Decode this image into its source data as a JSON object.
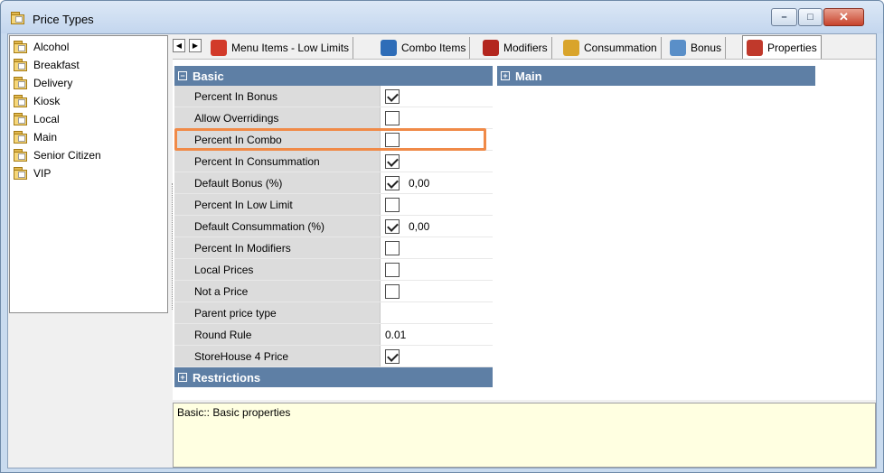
{
  "window": {
    "title": "Price Types",
    "minimize_glyph": "–",
    "maximize_glyph": "□",
    "close_glyph": "✕"
  },
  "sidebar": {
    "items": [
      {
        "label": "Alcohol"
      },
      {
        "label": "Breakfast"
      },
      {
        "label": "Delivery"
      },
      {
        "label": "Kiosk"
      },
      {
        "label": "Local"
      },
      {
        "label": "Main"
      },
      {
        "label": "Senior Citizen"
      },
      {
        "label": "VIP"
      }
    ]
  },
  "tabs": {
    "prev_glyph": "◀",
    "next_glyph": "▶",
    "items": [
      {
        "label": "Menu Items - Low Limits",
        "icon": "pie-chart-icon",
        "color": "#d23a2a"
      },
      {
        "label": "Combo Items",
        "icon": "combo-icon",
        "color": "#2e6db8"
      },
      {
        "label": "Modifiers",
        "icon": "bottles-icon",
        "color": "#b3261e"
      },
      {
        "label": "Consummation",
        "icon": "hourglass-icon",
        "color": "#d9a42b"
      },
      {
        "label": "Bonus",
        "icon": "calculator-icon",
        "color": "#5a8fc8"
      },
      {
        "label": "Properties",
        "icon": "properties-icon",
        "color": "#c0392b"
      }
    ]
  },
  "grid": {
    "basic_category": "Basic",
    "basic_toggle": "−",
    "main_category": "Main",
    "main_toggle": "+",
    "restrictions_category": "Restrictions",
    "restrictions_toggle": "+",
    "rows": [
      {
        "name": "Percent In Bonus",
        "checkbox": true,
        "checked": true,
        "value": ""
      },
      {
        "name": "Allow Overridings",
        "checkbox": true,
        "checked": false,
        "value": ""
      },
      {
        "name": "Percent In Combo",
        "checkbox": true,
        "checked": false,
        "value": ""
      },
      {
        "name": "Percent In Consummation",
        "checkbox": true,
        "checked": true,
        "value": ""
      },
      {
        "name": "Default Bonus (%)",
        "checkbox": true,
        "checked": true,
        "value": "0,00"
      },
      {
        "name": "Percent In Low Limit",
        "checkbox": true,
        "checked": false,
        "value": ""
      },
      {
        "name": "Default Consummation (%)",
        "checkbox": true,
        "checked": true,
        "value": "0,00"
      },
      {
        "name": "Percent In Modifiers",
        "checkbox": true,
        "checked": false,
        "value": ""
      },
      {
        "name": "Local Prices",
        "checkbox": true,
        "checked": false,
        "value": ""
      },
      {
        "name": "Not a Price",
        "checkbox": true,
        "checked": false,
        "value": ""
      },
      {
        "name": "Parent price type",
        "checkbox": false,
        "checked": false,
        "value": ""
      },
      {
        "name": "Round Rule",
        "checkbox": false,
        "checked": false,
        "value": "0.01"
      },
      {
        "name": "StoreHouse 4 Price",
        "checkbox": true,
        "checked": true,
        "value": ""
      }
    ]
  },
  "description": {
    "text": "Basic:: Basic properties"
  },
  "colors": {
    "category_header": "#5e7fa5",
    "highlight": "#f08a48",
    "description_bg": "#ffffe1"
  }
}
